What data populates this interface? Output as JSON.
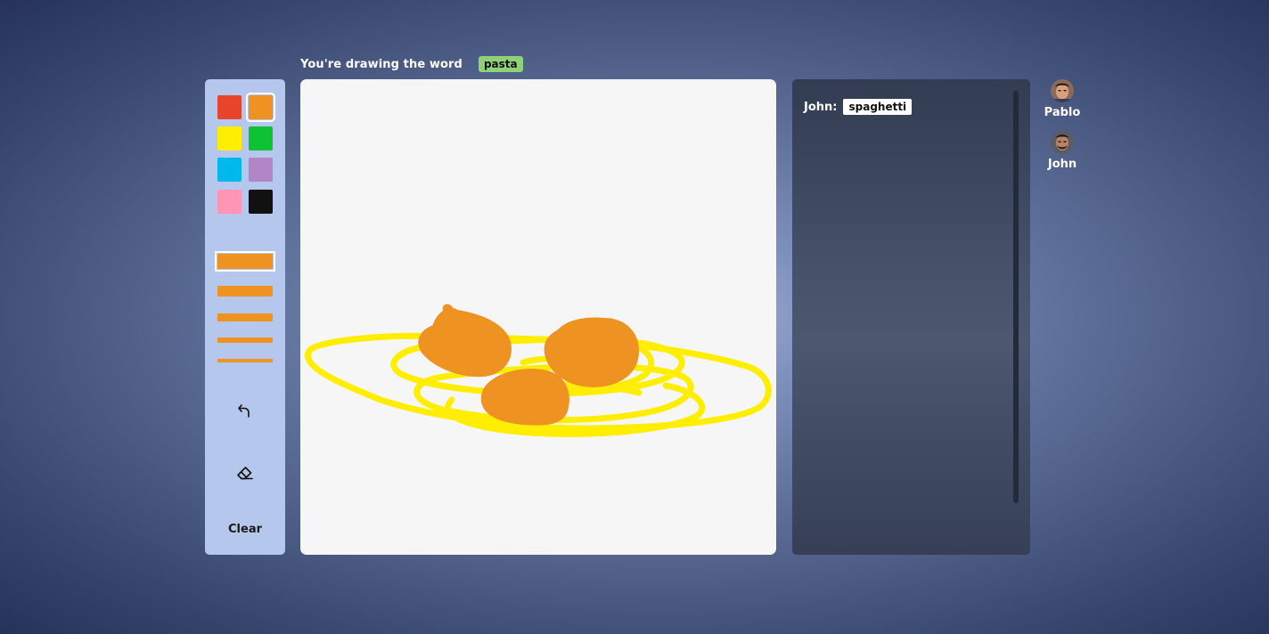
{
  "header": {
    "prompt": "You're drawing the word",
    "word": "pasta"
  },
  "toolbar": {
    "colors": [
      {
        "name": "red",
        "hex": "#e8432b",
        "selected": false
      },
      {
        "name": "orange",
        "hex": "#ee9322",
        "selected": true
      },
      {
        "name": "yellow",
        "hex": "#ffee00",
        "selected": false
      },
      {
        "name": "green",
        "hex": "#0fc234",
        "selected": false
      },
      {
        "name": "cyan",
        "hex": "#00b8eb",
        "selected": false
      },
      {
        "name": "purple",
        "hex": "#b286c6",
        "selected": false
      },
      {
        "name": "pink",
        "hex": "#ff95b4",
        "selected": false
      },
      {
        "name": "black",
        "hex": "#111111",
        "selected": false
      }
    ],
    "stroke_color": "#ee9322",
    "undo_icon": "undo-icon",
    "eraser_icon": "eraser-icon",
    "clear_label": "Clear"
  },
  "canvas": {
    "background": "#f6f6f6",
    "drawing_colors": [
      "#ffee00",
      "#ee9322"
    ]
  },
  "chat": {
    "messages": [
      {
        "author": "John:",
        "text": "spaghetti"
      }
    ]
  },
  "players": [
    {
      "name": "Pablo",
      "avatar": "avatar-pablo"
    },
    {
      "name": "John",
      "avatar": "avatar-john"
    }
  ]
}
